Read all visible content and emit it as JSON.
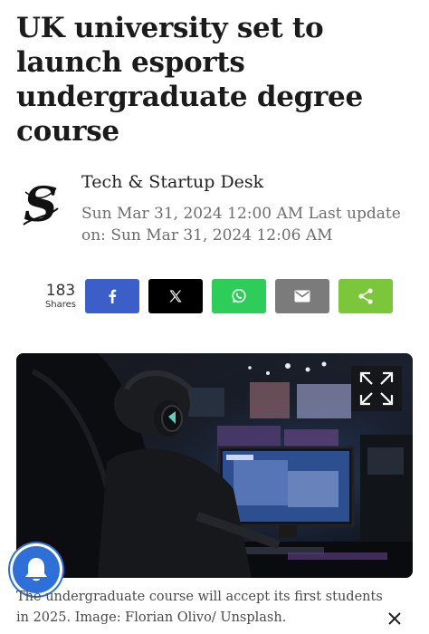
{
  "article": {
    "headline": "UK university set to launch esports undergraduate degree course",
    "author": "Tech & Startup Desk",
    "published": "Sun Mar 31, 2024 12:00 AM",
    "last_update_label": "Last update on:",
    "last_update": "Sun Mar 31, 2024 12:06 AM",
    "caption": "The undergraduate course will accept its first students in 2025. Image: Florian Olivo/ Unsplash."
  },
  "share_bar": {
    "count": "183",
    "count_label": "Shares",
    "buttons": [
      {
        "network": "facebook",
        "icon": "facebook-icon",
        "color": "#3b5ec8"
      },
      {
        "network": "x",
        "icon": "x-icon",
        "color": "#000000"
      },
      {
        "network": "whatsapp",
        "icon": "whatsapp-icon",
        "color": "#2ecc59"
      },
      {
        "network": "email",
        "icon": "mail-icon",
        "color": "#7b7b7b"
      },
      {
        "network": "share",
        "icon": "share-icon",
        "color": "#7cc63c"
      }
    ]
  },
  "icons": {
    "logo": "publication-s-logo",
    "expand": "expand-icon",
    "notifications": "bell-icon",
    "close": "close-icon"
  }
}
